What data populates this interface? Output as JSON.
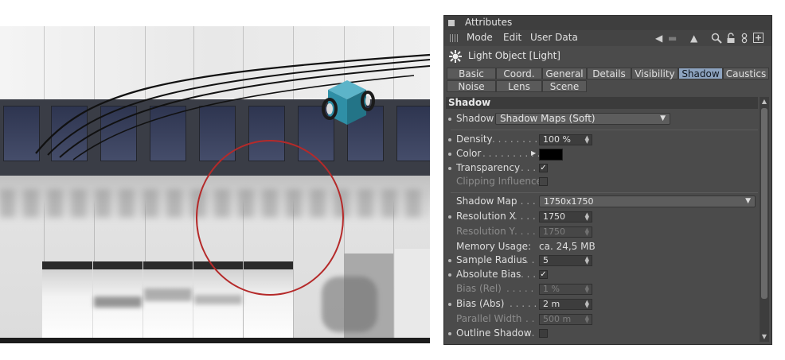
{
  "attributes": {
    "title": "Attributes",
    "menu": [
      "Mode",
      "Edit",
      "User Data"
    ],
    "toolbar_icons": [
      "back-arrow-icon",
      "forward-arrow-icon",
      "up-arrow-icon",
      "search-icon",
      "lock-icon",
      "link-icon",
      "new-panel-icon"
    ],
    "object_title": "Light Object [Light]",
    "tabs_row1": [
      "Basic",
      "Coord.",
      "General",
      "Details",
      "Visibility",
      "Shadow",
      "Caustics"
    ],
    "tabs_row2": [
      "Noise",
      "Lens",
      "Scene"
    ],
    "active_tab": "Shadow",
    "section_title": "Shadow",
    "shadow_label": "Shadow",
    "shadow_value": "Shadow Maps (Soft)",
    "density_label": "Density",
    "density_value": "100 %",
    "color_label": "Color",
    "color_value": "#000000",
    "transparency_label": "Transparency",
    "transparency_checked": true,
    "clipping_label": "Clipping Influence",
    "clipping_checked": false,
    "shadow_map_label": "Shadow Map",
    "shadow_map_value": "1750x1750",
    "res_x_label": "Resolution X",
    "res_x_value": "1750",
    "res_y_label": "Resolution Y",
    "res_y_value": "1750",
    "memory_label": "Memory Usage:",
    "memory_value": "ca. 24,5 MB",
    "sample_radius_label": "Sample Radius",
    "sample_radius_value": "5",
    "abs_bias_label": "Absolute Bias",
    "abs_bias_checked": true,
    "bias_rel_label": "Bias (Rel)",
    "bias_rel_value": "1 %",
    "bias_abs_label": "Bias (Abs)",
    "bias_abs_value": "2 m",
    "parallel_width_label": "Parallel Width",
    "parallel_width_value": "500 m",
    "outline_shadow_label": "Outline Shadow",
    "outline_shadow_checked": false
  },
  "colors": {
    "panel_bg": "#4b4b4b",
    "active_tab": "#8da3bf",
    "highlight_circle": "#b52a2a",
    "cube": "#2f8fa6"
  }
}
